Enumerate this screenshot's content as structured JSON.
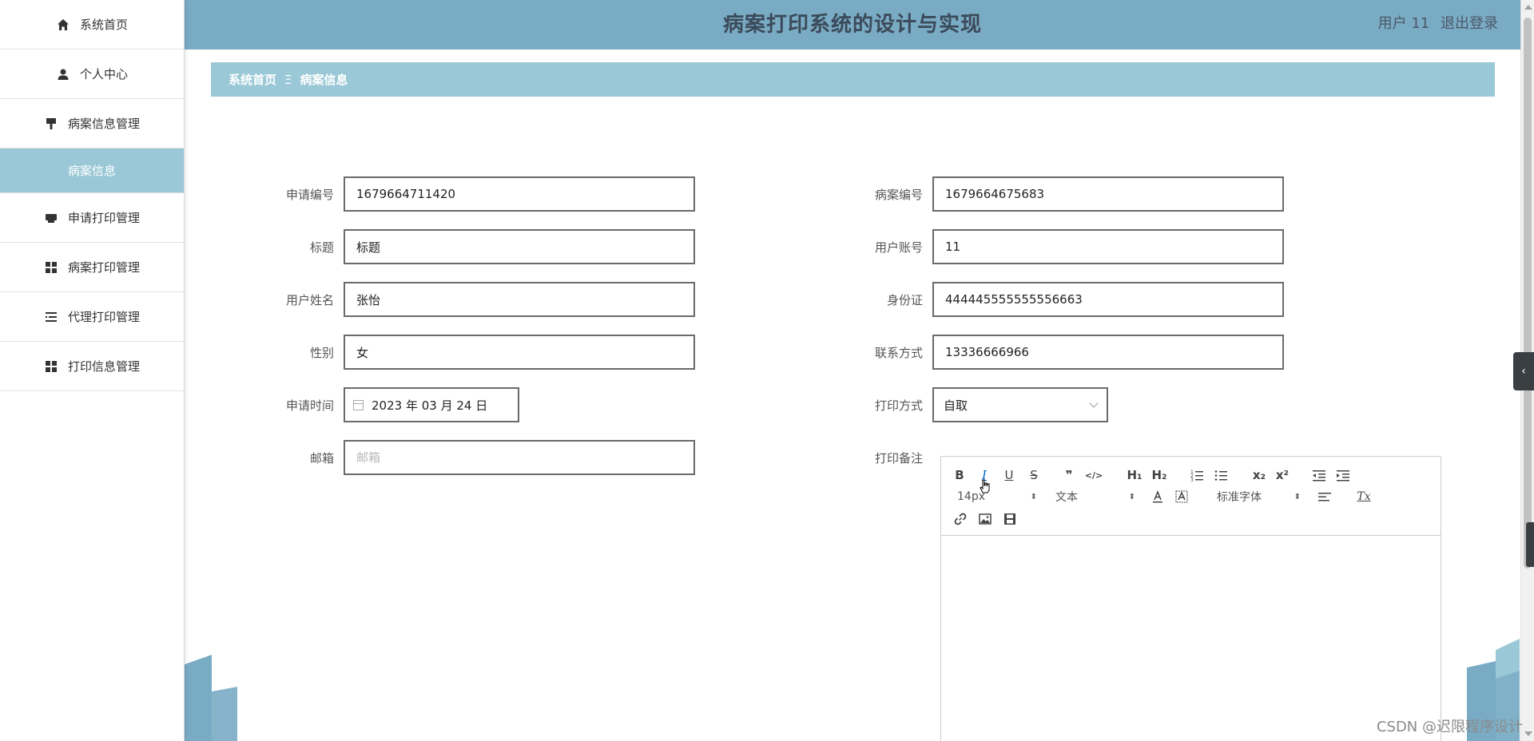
{
  "header": {
    "title": "病案打印系统的设计与实现",
    "user_label": "用户 11",
    "logout_label": "退出登录"
  },
  "sidebar": {
    "items": [
      {
        "label": "系统首页",
        "icon": "home-icon"
      },
      {
        "label": "个人中心",
        "icon": "user-icon"
      },
      {
        "label": "病案信息管理",
        "icon": "paint-icon"
      },
      {
        "label": "申请打印管理",
        "icon": "printer-icon"
      },
      {
        "label": "病案打印管理",
        "icon": "grid-icon"
      },
      {
        "label": "代理打印管理",
        "icon": "list-icon"
      },
      {
        "label": "打印信息管理",
        "icon": "grid-icon"
      }
    ],
    "active_sub": "病案信息"
  },
  "breadcrumb": {
    "home": "系统首页",
    "separator": "Ξ",
    "current": "病案信息"
  },
  "form": {
    "left": [
      {
        "label": "申请编号",
        "value": "1679664711420"
      },
      {
        "label": "标题",
        "value": "标题"
      },
      {
        "label": "用户姓名",
        "value": "张怡"
      },
      {
        "label": "性别",
        "value": "女"
      },
      {
        "label": "申请时间",
        "value": "2023 年 03 月 24 日"
      },
      {
        "label": "邮箱",
        "value": "",
        "placeholder": "邮箱"
      }
    ],
    "right": [
      {
        "label": "病案编号",
        "value": "1679664675683"
      },
      {
        "label": "用户账号",
        "value": "11"
      },
      {
        "label": "身份证",
        "value": "444445555555556663"
      },
      {
        "label": "联系方式",
        "value": "13336666966"
      },
      {
        "label": "打印方式",
        "value": "自取"
      },
      {
        "label": "打印备注"
      }
    ]
  },
  "editor": {
    "bold": "B",
    "italic": "I",
    "underline": "U",
    "strike": "S",
    "quote": "❞",
    "code": "</>",
    "h1": "H₁",
    "h2": "H₂",
    "sub": "x₂",
    "sup": "x²",
    "size_select": "14px",
    "header_select": "文本",
    "font_select": "标准字体",
    "clean": "Tx"
  },
  "watermark": "CSDN @迟限程序设计",
  "colors": {
    "header_bg": "#7aabc4",
    "accent": "#9ac8d6",
    "title_text": "#3b4a5a"
  }
}
